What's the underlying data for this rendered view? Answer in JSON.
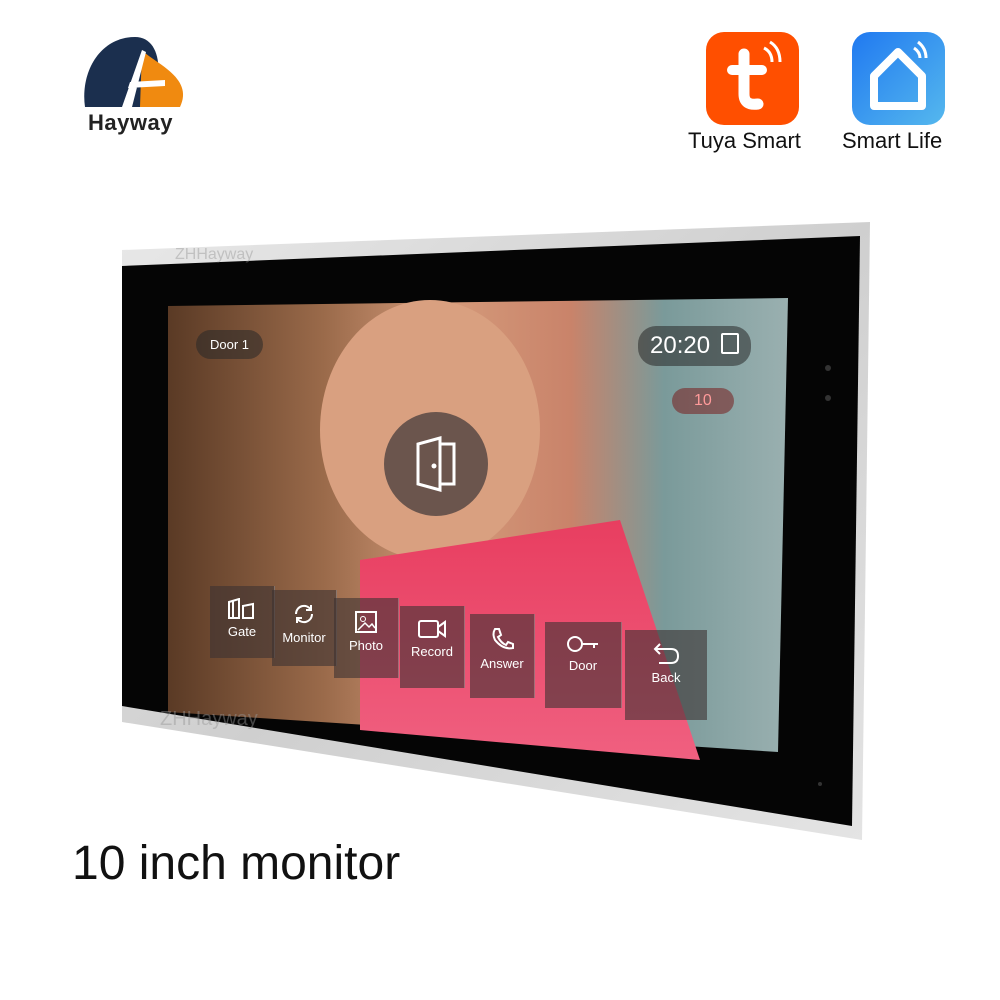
{
  "brand": {
    "name": "Hayway",
    "colors": {
      "dark": "#1b2f4e",
      "orange": "#f08a10"
    }
  },
  "apps": [
    {
      "label": "Tuya Smart",
      "icon": "tuya-t-icon",
      "color": "#ff4f00"
    },
    {
      "label": "Smart Life",
      "icon": "smart-home-icon",
      "color": "#2f8ff0"
    }
  ],
  "monitor": {
    "watermark": "ZHHayway",
    "screen": {
      "door_label": "Door 1",
      "time": "20:20",
      "count": "10",
      "center_icon": "door-open-icon",
      "buttons": [
        {
          "label": "Gate",
          "icon": "gate-icon"
        },
        {
          "label": "Monitor",
          "icon": "refresh-icon"
        },
        {
          "label": "Photo",
          "icon": "photo-icon"
        },
        {
          "label": "Record",
          "icon": "video-camera-icon"
        },
        {
          "label": "Answer",
          "icon": "phone-icon"
        },
        {
          "label": "Door",
          "icon": "key-icon"
        },
        {
          "label": "Back",
          "icon": "back-arrow-icon"
        }
      ]
    }
  },
  "caption": "10 inch monitor"
}
